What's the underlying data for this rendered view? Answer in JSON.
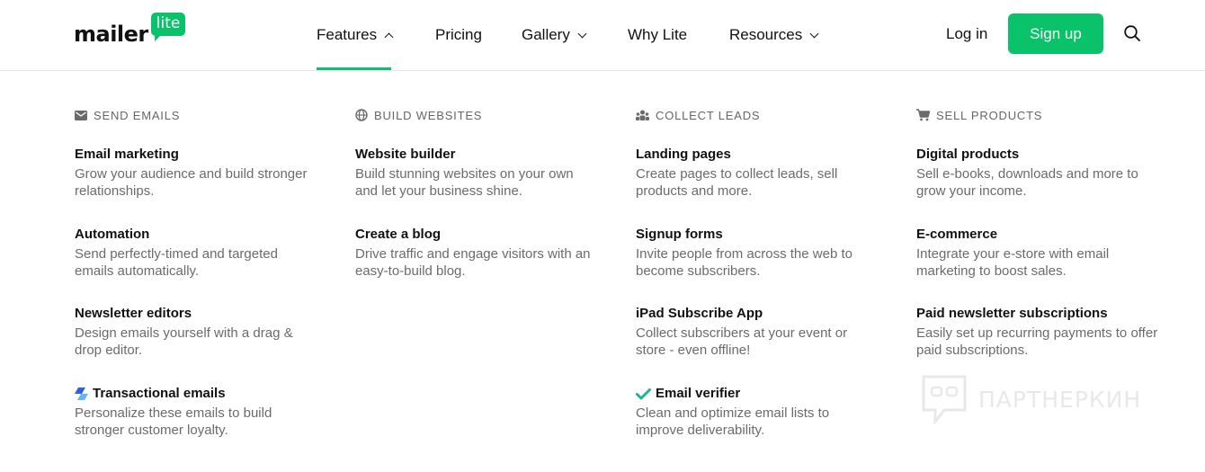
{
  "brand": {
    "word": "mailer",
    "badge": "lite",
    "color": "#09c269"
  },
  "nav": {
    "features": "Features",
    "pricing": "Pricing",
    "gallery": "Gallery",
    "why_lite": "Why Lite",
    "resources": "Resources"
  },
  "actions": {
    "login": "Log in",
    "signup": "Sign up"
  },
  "columns": [
    {
      "heading": "SEND EMAILS",
      "icon": "envelope-icon",
      "items": [
        {
          "title": "Email marketing",
          "desc": "Grow your audience and build stronger relationships."
        },
        {
          "title": "Automation",
          "desc": "Send perfectly-timed and targeted emails automatically."
        },
        {
          "title": "Newsletter editors",
          "desc": "Design emails yourself with a drag & drop editor."
        },
        {
          "title": "Transactional emails",
          "desc": "Personalize these emails to build stronger customer loyalty.",
          "icon": "mailersend-icon"
        }
      ]
    },
    {
      "heading": "BUILD WEBSITES",
      "icon": "globe-icon",
      "items": [
        {
          "title": "Website builder",
          "desc": "Build stunning websites on your own and let your business shine."
        },
        {
          "title": "Create a blog",
          "desc": "Drive traffic and engage visitors with an easy-to-build blog."
        }
      ]
    },
    {
      "heading": "COLLECT LEADS",
      "icon": "people-icon",
      "items": [
        {
          "title": "Landing pages",
          "desc": "Create pages to collect leads, sell products and more."
        },
        {
          "title": "Signup forms",
          "desc": "Invite people from across the web to become subscribers."
        },
        {
          "title": "iPad Subscribe App",
          "desc": "Collect subscribers at your event or store - even offline!"
        },
        {
          "title": "Email verifier",
          "desc": "Clean and optimize email lists to improve deliverability.",
          "icon": "checkmark-icon"
        }
      ]
    },
    {
      "heading": "SELL PRODUCTS",
      "icon": "cart-icon",
      "items": [
        {
          "title": "Digital products",
          "desc": "Sell e-books, downloads and more to grow your income."
        },
        {
          "title": "E-commerce",
          "desc": "Integrate your e-store with email marketing to boost sales."
        },
        {
          "title": "Paid newsletter subscriptions",
          "desc": "Easily set up recurring payments to offer paid subscriptions."
        }
      ]
    }
  ],
  "watermark": {
    "text": "ПАРТНЕРКИН"
  }
}
